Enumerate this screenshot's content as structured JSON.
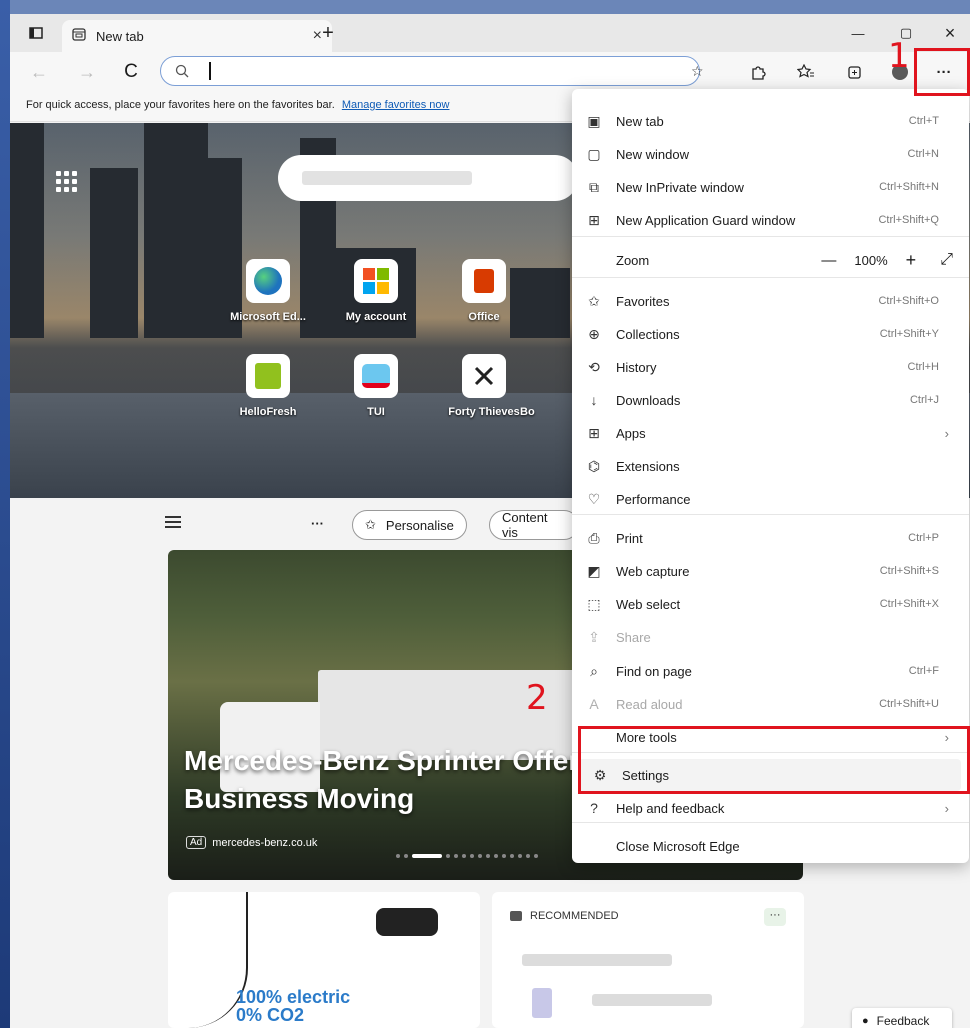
{
  "tab": {
    "title": "New tab",
    "close": "×",
    "new_tab": "+"
  },
  "window": {
    "minimize": "—",
    "maximize": "▢",
    "close": "×"
  },
  "toolbar": {
    "back": "←",
    "forward": "→",
    "refresh": "C",
    "more": "···"
  },
  "favorites_bar": {
    "text": "For quick access, place your favorites here on the favorites bar.",
    "link": "Manage favorites now"
  },
  "hero": {
    "tiles": [
      {
        "label": "Microsoft Ed...",
        "icon": "edge-icon",
        "color": "#1e73be"
      },
      {
        "label": "My account",
        "icon": "microsoft-icon",
        "color": "#f25022"
      },
      {
        "label": "Office",
        "icon": "office-icon",
        "color": "#d83b01"
      },
      {
        "label": "HelloFresh",
        "icon": "hellofresh-icon",
        "color": "#91c11e"
      },
      {
        "label": "TUI",
        "icon": "tui-icon",
        "color": "#e2001a"
      },
      {
        "label": "Forty Thieves",
        "icon": "forty-thieves-icon",
        "color": "#222222"
      },
      {
        "label": "Bo",
        "icon": "partial-icon",
        "color": "#ffffff"
      }
    ]
  },
  "feed": {
    "more": "···",
    "personalise": "Personalise",
    "content": "Content vis"
  },
  "ad": {
    "title_line1": "Mercedes-Benz Sprinter Offer",
    "title_line2": "Business Moving",
    "tag": "Ad",
    "source": "mercedes-benz.co.uk"
  },
  "electric": {
    "line1": "100% electric",
    "line2": "0% CO2"
  },
  "recommended": {
    "label": "RECOMMENDED",
    "more": "···"
  },
  "feedback": {
    "label": "Feedback"
  },
  "menu": {
    "items": [
      {
        "id": "new-tab",
        "label": "New tab",
        "shortcut": "Ctrl+T",
        "icon": "new-tab-icon"
      },
      {
        "id": "new-window",
        "label": "New window",
        "shortcut": "Ctrl+N",
        "icon": "new-window-icon"
      },
      {
        "id": "new-inprivate",
        "label": "New InPrivate window",
        "shortcut": "Ctrl+Shift+N",
        "icon": "inprivate-icon"
      },
      {
        "id": "new-app-guard",
        "label": "New Application Guard window",
        "shortcut": "Ctrl+Shift+Q",
        "icon": "app-guard-icon"
      },
      {
        "id": "favorites",
        "label": "Favorites",
        "shortcut": "Ctrl+Shift+O",
        "icon": "favorites-icon"
      },
      {
        "id": "collections",
        "label": "Collections",
        "shortcut": "Ctrl+Shift+Y",
        "icon": "collections-icon"
      },
      {
        "id": "history",
        "label": "History",
        "shortcut": "Ctrl+H",
        "icon": "history-icon"
      },
      {
        "id": "downloads",
        "label": "Downloads",
        "shortcut": "Ctrl+J",
        "icon": "downloads-icon"
      },
      {
        "id": "apps",
        "label": "Apps",
        "shortcut": "",
        "icon": "apps-icon"
      },
      {
        "id": "extensions",
        "label": "Extensions",
        "shortcut": "",
        "icon": "extensions-icon"
      },
      {
        "id": "performance",
        "label": "Performance",
        "shortcut": "",
        "icon": "performance-icon"
      },
      {
        "id": "print",
        "label": "Print",
        "shortcut": "Ctrl+P",
        "icon": "print-icon"
      },
      {
        "id": "web-capture",
        "label": "Web capture",
        "shortcut": "Ctrl+Shift+S",
        "icon": "web-capture-icon"
      },
      {
        "id": "web-select",
        "label": "Web select",
        "shortcut": "Ctrl+Shift+X",
        "icon": "web-select-icon"
      },
      {
        "id": "share",
        "label": "Share",
        "shortcut": "",
        "icon": "share-icon"
      },
      {
        "id": "find-on-page",
        "label": "Find on page",
        "shortcut": "Ctrl+F",
        "icon": "find-icon"
      },
      {
        "id": "read-aloud",
        "label": "Read aloud",
        "shortcut": "Ctrl+Shift+U",
        "icon": "read-aloud-icon"
      },
      {
        "id": "more-tools",
        "label": "More tools",
        "shortcut": "",
        "icon": "more-tools-icon"
      },
      {
        "id": "settings",
        "label": "Settings",
        "shortcut": "",
        "icon": "settings-icon"
      },
      {
        "id": "help",
        "label": "Help and feedback",
        "shortcut": "",
        "icon": "help-icon"
      },
      {
        "id": "close-edge",
        "label": "Close Microsoft Edge",
        "shortcut": "",
        "icon": "close-edge-icon"
      }
    ],
    "zoom": {
      "label": "Zoom",
      "minus": "—",
      "value": "100%",
      "plus": "+",
      "fullscreen": "⤢"
    }
  },
  "annotations": {
    "step1": "1",
    "step2": "2",
    "color": "#e0141e"
  }
}
